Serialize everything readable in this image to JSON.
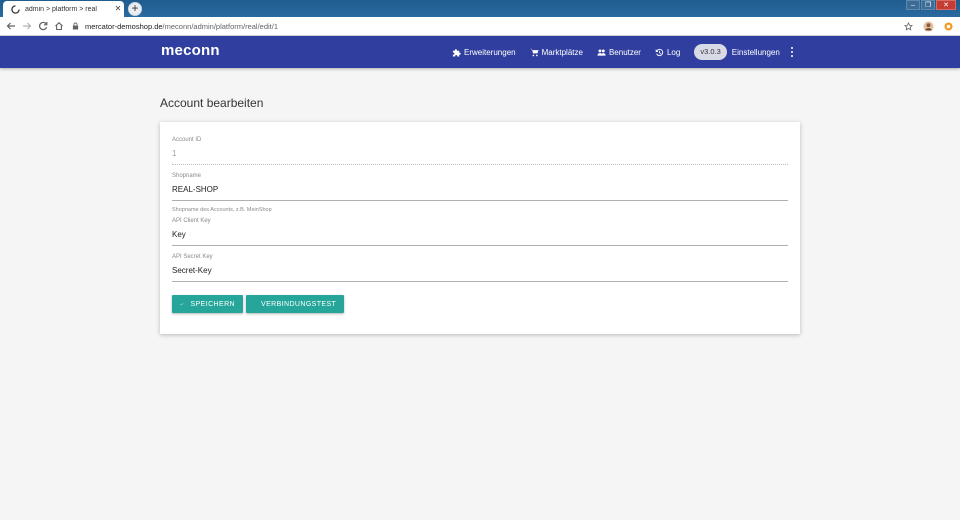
{
  "browser": {
    "tab_title": "admin > platform > real",
    "url_host": "mercator-demoshop.de",
    "url_path": "/meconn/admin/platform/real/edit/1"
  },
  "app": {
    "logo": "meconn",
    "nav": [
      {
        "label": "Erweiterungen",
        "icon": "puzzle-icon"
      },
      {
        "label": "Marktplätze",
        "icon": "cart-icon"
      },
      {
        "label": "Benutzer",
        "icon": "people-icon"
      },
      {
        "label": "Log",
        "icon": "history-icon"
      }
    ],
    "version": "v3.0.3",
    "settings_label": "Einstellungen"
  },
  "page": {
    "title": "Account bearbeiten"
  },
  "form": {
    "account_id": {
      "label": "Account ID",
      "value": "1"
    },
    "shopname": {
      "label": "Shopname",
      "value": "REAL-SHOP",
      "hint": "Shopname des Accounts, z.B. MeinShop"
    },
    "api_client_key": {
      "label": "API Client Key",
      "value": "Key"
    },
    "api_secret_key": {
      "label": "API Secret Key",
      "value": "Secret-Key"
    }
  },
  "actions": {
    "save_label": "SPEICHERN",
    "test_label": "VERBINDUNGSTEST"
  },
  "colors": {
    "appbar": "#303f9f",
    "button": "#26a69a",
    "background": "#f5f5f5"
  }
}
